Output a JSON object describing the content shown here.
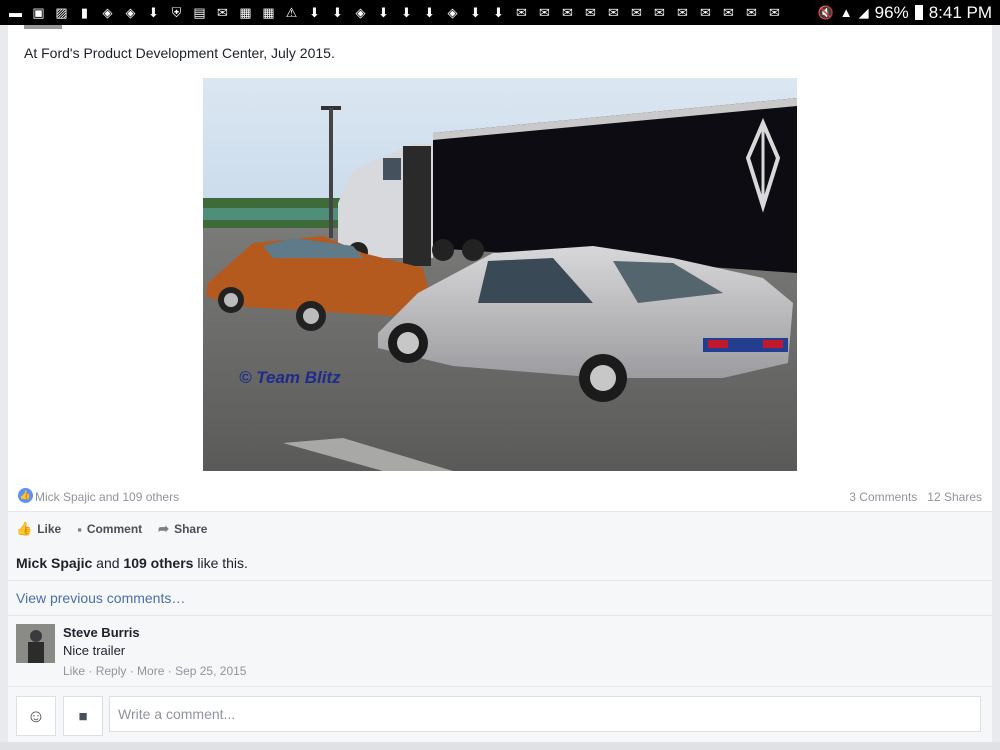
{
  "status_bar": {
    "notification_icons": [
      "message-icon",
      "gallery-icon",
      "photo-icon",
      "file-icon",
      "money-icon",
      "money-icon",
      "download-icon",
      "shield-icon",
      "app-icon",
      "mail-icon",
      "calendar-icon",
      "calendar-icon",
      "warning-icon",
      "download-off-icon",
      "download-off-icon",
      "money-icon",
      "download-icon",
      "download-icon",
      "download-icon",
      "money-icon",
      "download-off-icon",
      "download-off-icon",
      "mail-off-icon",
      "mail-off-icon",
      "mail-off-icon",
      "mail-off-icon",
      "mail-off-icon",
      "mail-off-icon",
      "mail-off-icon",
      "mail-off-icon",
      "mail-off-icon",
      "mail-off-icon",
      "mail-off-icon",
      "email-icon"
    ],
    "battery": "96%",
    "time": "8:41 PM"
  },
  "post": {
    "caption": "At Ford's Product Development Center, July 2015.",
    "photo_watermark": "© Team Blitz",
    "reactions": {
      "likes_text": "Mick Spajic and 109 others",
      "comments_count": "3 Comments",
      "shares_count": "12 Shares"
    },
    "actions": {
      "like": "Like",
      "comment": "Comment",
      "share": "Share"
    },
    "likes_summary": {
      "name": "Mick Spajic",
      "connector": " and ",
      "others": "109 others",
      "suffix": " like this."
    },
    "view_previous": "View previous comments…",
    "comments": [
      {
        "author": "Steve Burris",
        "text": "Nice trailer",
        "like": "Like",
        "reply": "Reply",
        "more": "More",
        "date": "Sep 25, 2015"
      }
    ],
    "composer": {
      "placeholder": "Write a comment..."
    }
  }
}
